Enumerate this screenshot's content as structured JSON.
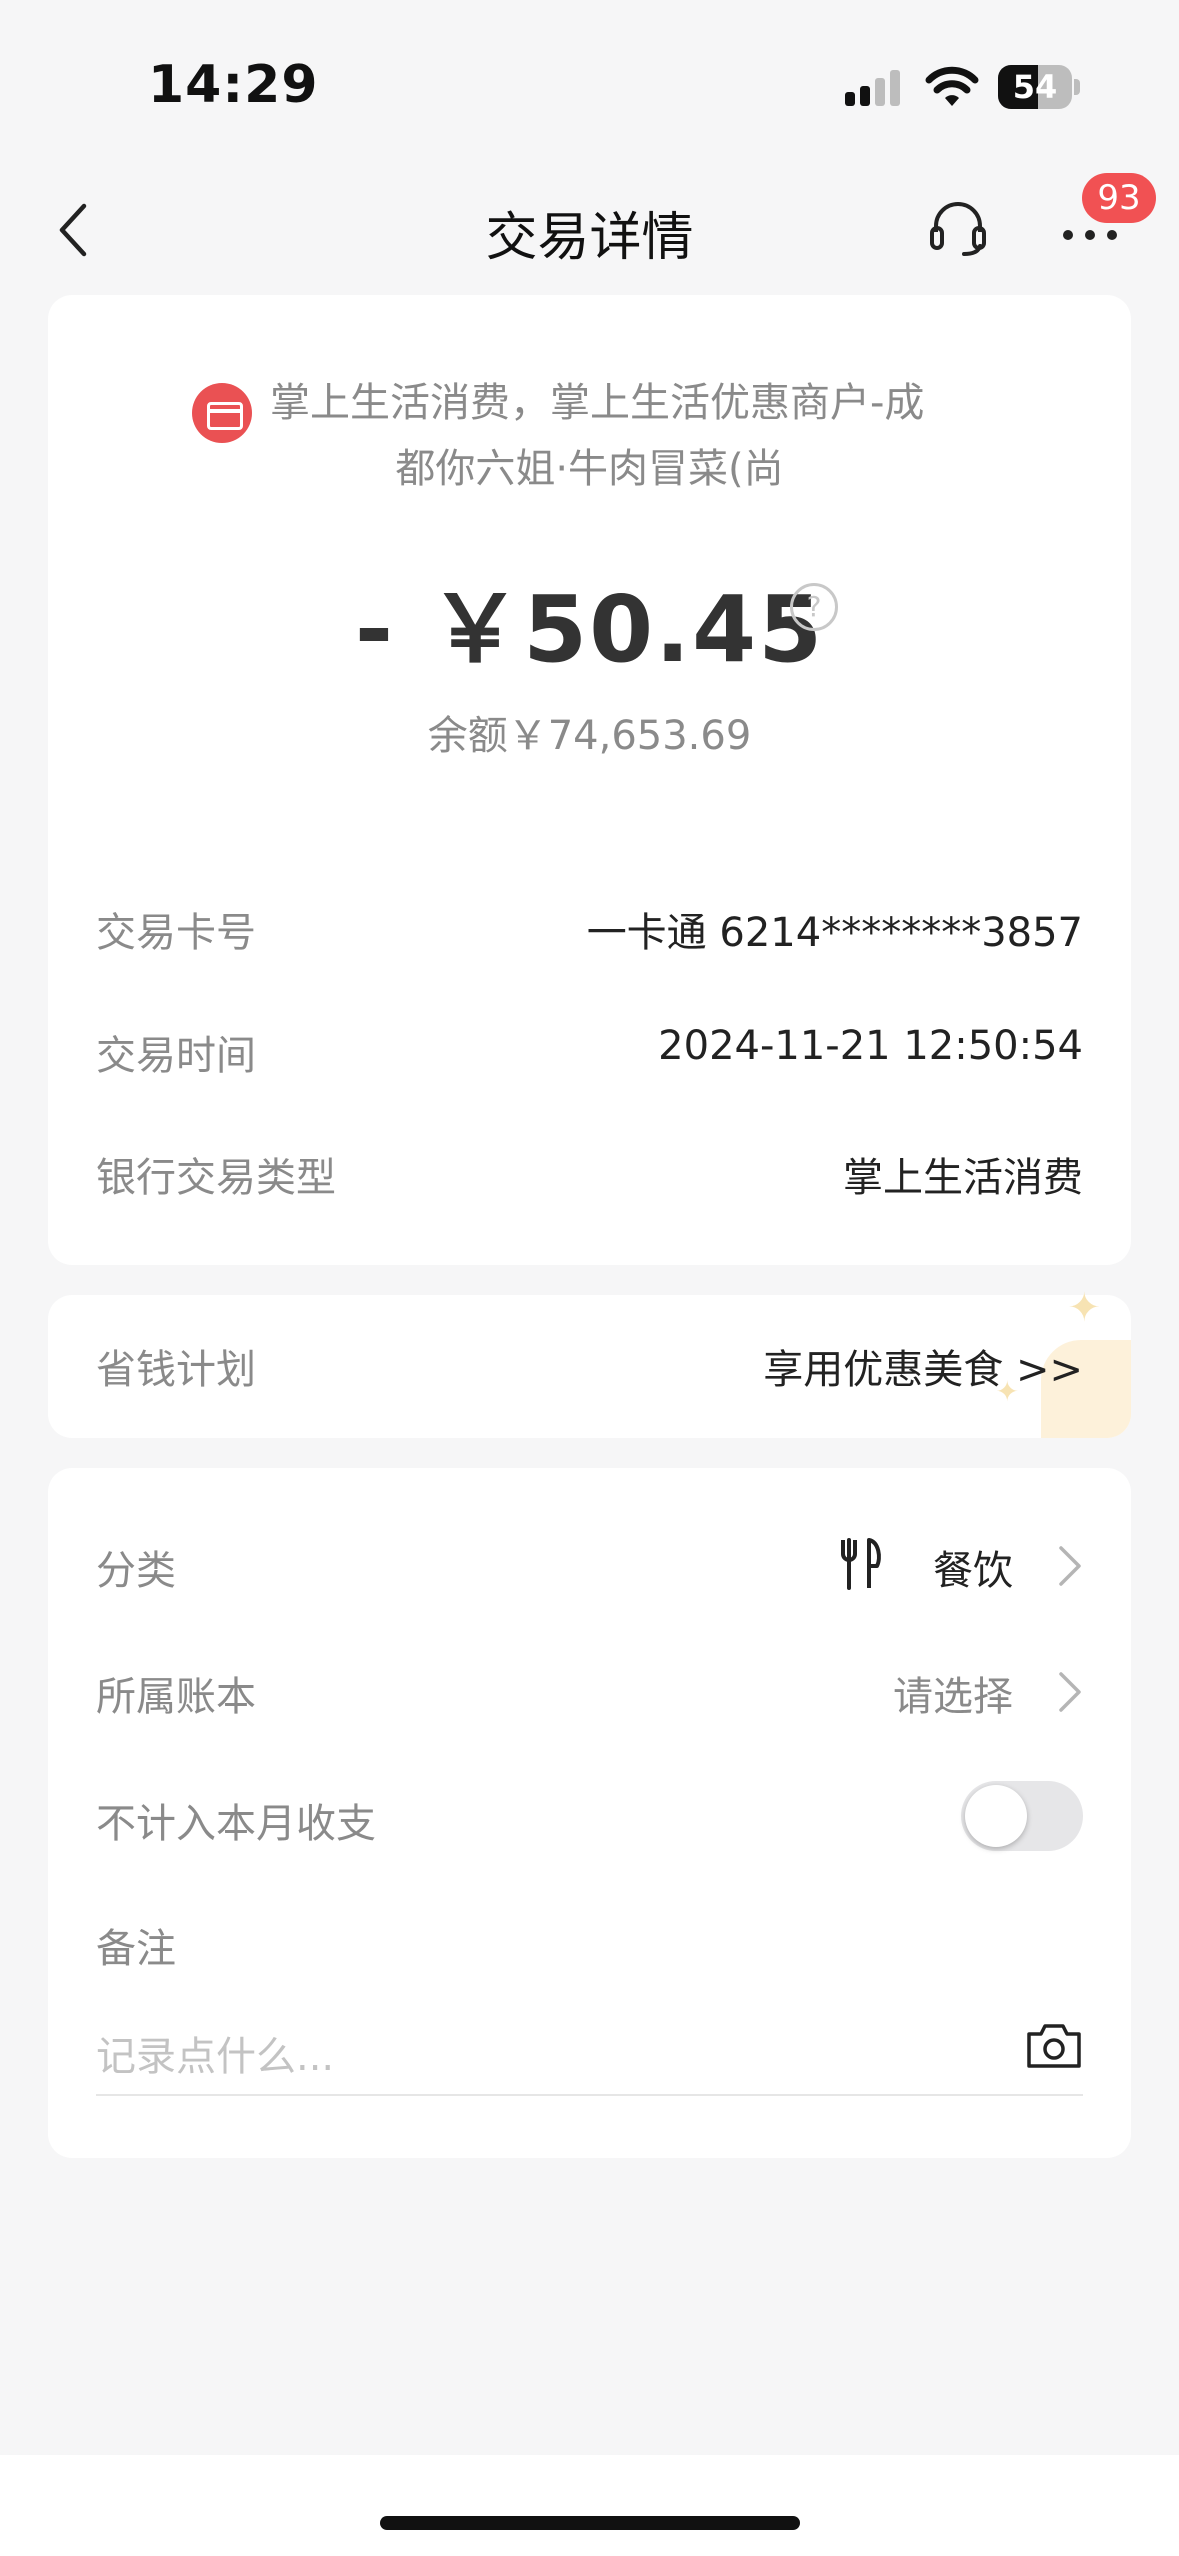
{
  "status_bar": {
    "time": "14:29",
    "battery": "54",
    "battery_level": 0.54
  },
  "nav": {
    "title": "交易详情",
    "badge_count": "93",
    "icons": {
      "back": "chevron-left-icon",
      "service": "headset-icon",
      "more": "more-dots-icon"
    }
  },
  "transaction": {
    "merchant": "掌上生活消费，掌上生活优惠商户-成",
    "merchant_line2": "都你六姐·牛肉冒菜(尚",
    "amount": "- ￥50.45",
    "help": "?",
    "balance": "余额￥74,653.69",
    "details": [
      {
        "label": "交易卡号",
        "value": "一卡通 6214********3857"
      },
      {
        "label": "交易时间",
        "value": "2024-11-21 12:50:54"
      },
      {
        "label": "银行交易类型",
        "value": "掌上生活消费"
      }
    ]
  },
  "save_plan": {
    "label": "省钱计划",
    "link": "享用优惠美食 >>"
  },
  "category_card": {
    "category_label": "分类",
    "category_value": "餐饮",
    "book_label": "所属账本",
    "book_value": "请选择",
    "exclude_label": "不计入本月收支",
    "exclude_enabled": false,
    "note_label": "备注",
    "note_placeholder": "记录点什么..."
  },
  "colors": {
    "accent_red": "#f15153",
    "background": "#f6f6f7",
    "card": "#ffffff",
    "muted_text": "#8a8a8a"
  }
}
